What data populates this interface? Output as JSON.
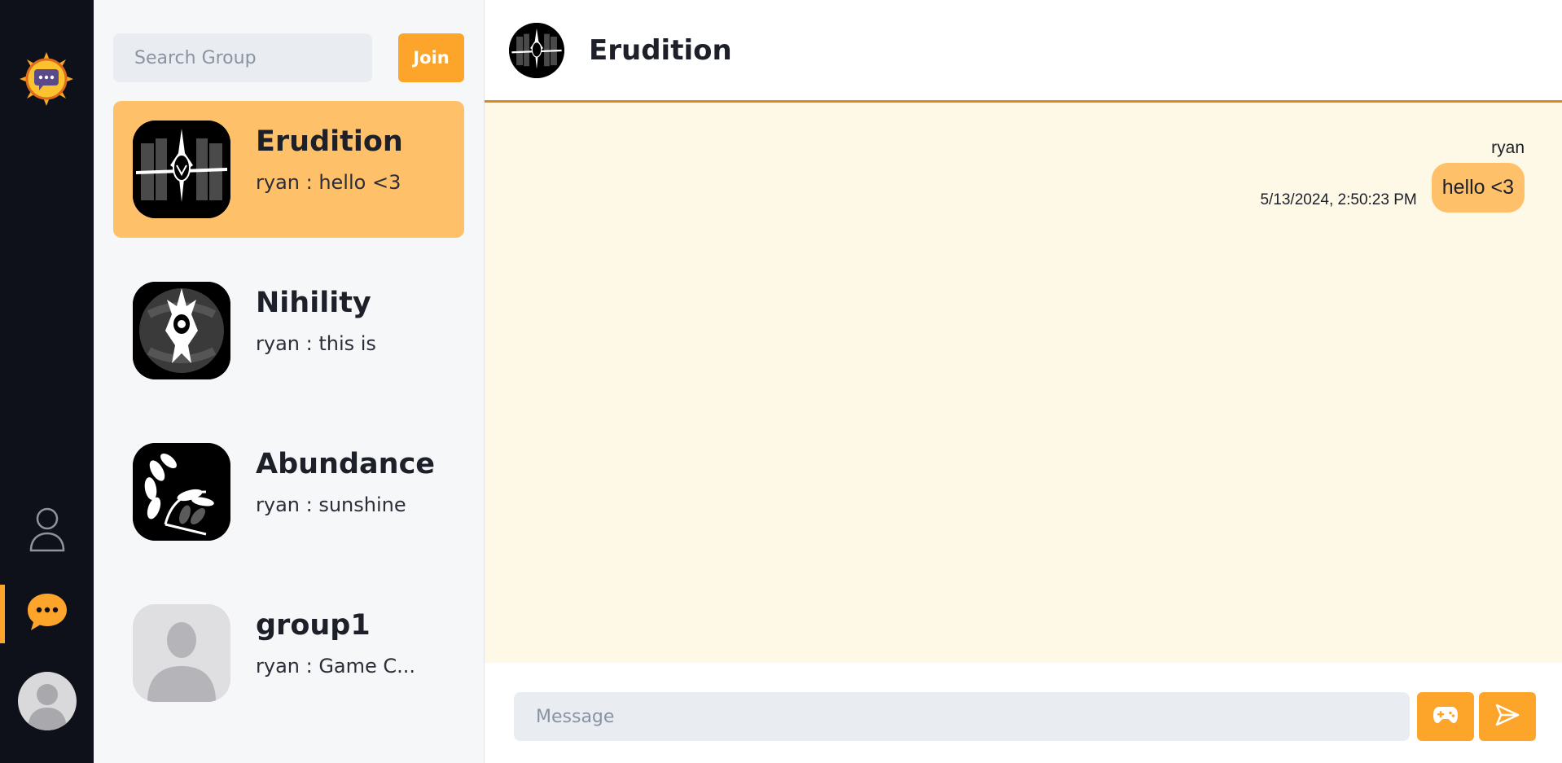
{
  "rail": {
    "logo_icon": "chat-sun-logo-icon",
    "profile_icon": "user-outline-icon",
    "chat_icon": "chat-bubble-dots-icon",
    "accent": "#fca52a"
  },
  "groups_panel": {
    "search_placeholder": "Search Group",
    "join_label": "Join",
    "add_label": "+",
    "groups": [
      {
        "name": "Erudition",
        "last_message": "ryan : hello <3",
        "active": true
      },
      {
        "name": "Nihility",
        "last_message": "ryan : this is",
        "active": false
      },
      {
        "name": "Abundance",
        "last_message": "ryan : sunshine",
        "active": false
      },
      {
        "name": "group1",
        "last_message": "ryan : Game C...",
        "active": false
      }
    ]
  },
  "chat": {
    "title": "Erudition",
    "messages": [
      {
        "sender": "ryan",
        "time": "5/13/2024, 2:50:23 PM",
        "text": "hello <3"
      }
    ],
    "input_placeholder": "Message",
    "game_icon": "gamepad-icon",
    "send_icon": "send-arrow-icon"
  }
}
